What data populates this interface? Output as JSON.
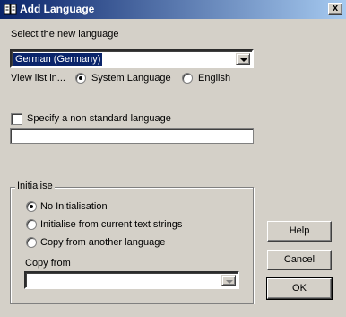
{
  "window": {
    "title": "Add Language",
    "close_label": "x"
  },
  "language": {
    "prompt": "Select the new language",
    "selected": "German (Germany)",
    "view_list_label": "View list in...",
    "view_options": [
      {
        "label": "System Language",
        "checked": true
      },
      {
        "label": "English",
        "checked": false
      }
    ]
  },
  "nonstandard": {
    "label": "Specify a non standard language",
    "checked": false,
    "value": ""
  },
  "initialise": {
    "legend": "Initialise",
    "options": [
      {
        "label": "No Initialisation",
        "checked": true
      },
      {
        "label": "Initialise from current text strings",
        "checked": false
      },
      {
        "label": "Copy from another language",
        "checked": false
      }
    ],
    "copy_from_label": "Copy from",
    "copy_from_value": ""
  },
  "buttons": {
    "help": "Help",
    "cancel": "Cancel",
    "ok": "OK"
  },
  "icons": {
    "title": "book-icon",
    "dropdown": "chevron-down-icon"
  }
}
